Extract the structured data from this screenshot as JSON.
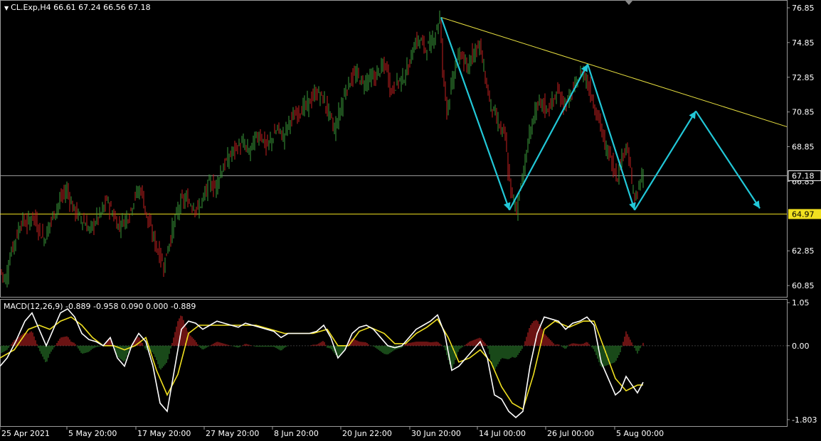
{
  "header": {
    "symbol_line": "CL.Exp,H4  66.61 67.24 66.56 67.18",
    "indicator_line": "MACD(12,26,9) -0.889 -0.958 0.090 0.000 -0.889"
  },
  "colors": {
    "background": "#000000",
    "bull": "#3a9a3a",
    "bear": "#c42020",
    "trendline": "#e8e040",
    "arrows": "#22c8d8",
    "macd_line": "#ffffff",
    "signal_line": "#f0e020",
    "hist_pos": "#b02020",
    "hist_neg": "#2a7a2a",
    "current_price_line": "#a0a0a0",
    "level_line": "#f0e020"
  },
  "chart_data": [
    {
      "type": "candlestick",
      "symbol": "CL.Exp",
      "timeframe": "H4",
      "ohlc_last": {
        "open": 66.61,
        "high": 67.24,
        "low": 66.56,
        "close": 67.18
      },
      "y_ticks": [
        "76.85",
        "74.85",
        "72.85",
        "70.85",
        "68.85",
        "66.85",
        "62.85",
        "60.85"
      ],
      "ylim": [
        60.2,
        77.3
      ],
      "x_ticks": [
        "25 Apr 2021",
        "5 May 20:00",
        "17 May 20:00",
        "27 May 20:00",
        "8 Jun 20:00",
        "20 Jun 22:00",
        "30 Jun 20:00",
        "14 Jul 00:00",
        "26 Jul 00:00",
        "5 Aug 00:00"
      ],
      "price_path": [
        [
          0,
          61.7
        ],
        [
          8,
          61.2
        ],
        [
          14,
          62.6
        ],
        [
          22,
          63.6
        ],
        [
          30,
          64.6
        ],
        [
          38,
          64.4
        ],
        [
          46,
          64.9
        ],
        [
          54,
          64.1
        ],
        [
          62,
          63.5
        ],
        [
          70,
          64.5
        ],
        [
          78,
          65.2
        ],
        [
          86,
          65.9
        ],
        [
          94,
          66.4
        ],
        [
          102,
          65.3
        ],
        [
          110,
          64.9
        ],
        [
          118,
          64.5
        ],
        [
          126,
          64.0
        ],
        [
          134,
          64.6
        ],
        [
          142,
          65.0
        ],
        [
          150,
          65.8
        ],
        [
          158,
          65.0
        ],
        [
          166,
          64.3
        ],
        [
          174,
          64.6
        ],
        [
          182,
          65.0
        ],
        [
          190,
          66.1
        ],
        [
          198,
          66.4
        ],
        [
          206,
          64.8
        ],
        [
          214,
          63.8
        ],
        [
          222,
          62.8
        ],
        [
          230,
          62.0
        ],
        [
          238,
          63.4
        ],
        [
          246,
          64.7
        ],
        [
          254,
          65.7
        ],
        [
          262,
          65.8
        ],
        [
          270,
          65.5
        ],
        [
          278,
          65.2
        ],
        [
          286,
          65.9
        ],
        [
          294,
          66.8
        ],
        [
          302,
          66.5
        ],
        [
          310,
          67.4
        ],
        [
          318,
          68.0
        ],
        [
          326,
          68.5
        ],
        [
          334,
          68.9
        ],
        [
          342,
          69.0
        ],
        [
          350,
          68.5
        ],
        [
          358,
          69.3
        ],
        [
          366,
          69.6
        ],
        [
          374,
          68.8
        ],
        [
          382,
          69.3
        ],
        [
          390,
          69.9
        ],
        [
          398,
          69.4
        ],
        [
          406,
          70.3
        ],
        [
          414,
          70.6
        ],
        [
          422,
          71.0
        ],
        [
          430,
          71.2
        ],
        [
          438,
          71.6
        ],
        [
          446,
          72.0
        ],
        [
          454,
          71.6
        ],
        [
          462,
          70.8
        ],
        [
          470,
          69.8
        ],
        [
          478,
          71.0
        ],
        [
          486,
          72.2
        ],
        [
          494,
          72.8
        ],
        [
          502,
          73.0
        ],
        [
          510,
          72.5
        ],
        [
          518,
          72.8
        ],
        [
          526,
          72.8
        ],
        [
          534,
          73.3
        ],
        [
          542,
          73.5
        ],
        [
          550,
          72.0
        ],
        [
          558,
          72.6
        ],
        [
          566,
          72.8
        ],
        [
          574,
          73.4
        ],
        [
          582,
          74.8
        ],
        [
          590,
          75.0
        ],
        [
          598,
          74.5
        ],
        [
          606,
          74.8
        ],
        [
          612,
          75.5
        ],
        [
          618,
          76.3
        ],
        [
          622,
          73.3
        ],
        [
          628,
          71.0
        ],
        [
          634,
          72.2
        ],
        [
          640,
          73.6
        ],
        [
          648,
          74.3
        ],
        [
          656,
          73.1
        ],
        [
          662,
          74.2
        ],
        [
          668,
          74.5
        ],
        [
          674,
          74.8
        ],
        [
          680,
          73.2
        ],
        [
          688,
          71.5
        ],
        [
          696,
          70.6
        ],
        [
          704,
          69.8
        ],
        [
          710,
          69.4
        ],
        [
          714,
          67.3
        ],
        [
          720,
          65.8
        ],
        [
          726,
          65.3
        ],
        [
          732,
          66.8
        ],
        [
          738,
          68.0
        ],
        [
          744,
          69.6
        ],
        [
          752,
          70.9
        ],
        [
          760,
          71.4
        ],
        [
          768,
          71.0
        ],
        [
          776,
          71.4
        ],
        [
          784,
          72.0
        ],
        [
          792,
          71.3
        ],
        [
          800,
          71.6
        ],
        [
          808,
          72.3
        ],
        [
          814,
          72.9
        ],
        [
          820,
          73.2
        ],
        [
          826,
          72.4
        ],
        [
          832,
          71.7
        ],
        [
          838,
          70.8
        ],
        [
          844,
          70.1
        ],
        [
          850,
          68.8
        ],
        [
          856,
          68.5
        ],
        [
          862,
          67.6
        ],
        [
          868,
          67.2
        ],
        [
          874,
          68.3
        ],
        [
          880,
          69.1
        ],
        [
          886,
          67.4
        ],
        [
          892,
          65.6
        ],
        [
          898,
          66.6
        ],
        [
          904,
          67.18
        ]
      ]
    },
    {
      "type": "line",
      "indicator": "MACD",
      "params": "12,26,9",
      "values": {
        "macd": -0.889,
        "signal": -0.958,
        "histogram": 0.09
      },
      "y_ticks": [
        "1.05",
        "0.00",
        "-1.803"
      ],
      "ylim": [
        -1.96,
        1.14
      ],
      "macd_path": [
        [
          0,
          -0.5
        ],
        [
          10,
          -0.3
        ],
        [
          22,
          0.1
        ],
        [
          35,
          0.6
        ],
        [
          45,
          0.8
        ],
        [
          55,
          0.4
        ],
        [
          65,
          0.0
        ],
        [
          75,
          0.4
        ],
        [
          85,
          0.8
        ],
        [
          95,
          0.9
        ],
        [
          105,
          0.7
        ],
        [
          115,
          0.3
        ],
        [
          125,
          0.15
        ],
        [
          135,
          0.1
        ],
        [
          145,
          0.0
        ],
        [
          155,
          0.2
        ],
        [
          165,
          -0.3
        ],
        [
          175,
          -0.5
        ],
        [
          185,
          0.0
        ],
        [
          195,
          0.3
        ],
        [
          205,
          0.1
        ],
        [
          215,
          -0.5
        ],
        [
          225,
          -1.4
        ],
        [
          235,
          -1.6
        ],
        [
          245,
          -0.6
        ],
        [
          255,
          0.4
        ],
        [
          265,
          0.6
        ],
        [
          275,
          0.55
        ],
        [
          285,
          0.4
        ],
        [
          295,
          0.5
        ],
        [
          305,
          0.6
        ],
        [
          315,
          0.55
        ],
        [
          325,
          0.5
        ],
        [
          335,
          0.45
        ],
        [
          345,
          0.55
        ],
        [
          355,
          0.5
        ],
        [
          365,
          0.45
        ],
        [
          375,
          0.4
        ],
        [
          385,
          0.35
        ],
        [
          395,
          0.2
        ],
        [
          405,
          0.3
        ],
        [
          415,
          0.3
        ],
        [
          425,
          0.3
        ],
        [
          435,
          0.3
        ],
        [
          445,
          0.35
        ],
        [
          455,
          0.5
        ],
        [
          465,
          0.2
        ],
        [
          475,
          -0.3
        ],
        [
          485,
          -0.1
        ],
        [
          495,
          0.3
        ],
        [
          505,
          0.45
        ],
        [
          515,
          0.5
        ],
        [
          525,
          0.4
        ],
        [
          535,
          0.2
        ],
        [
          545,
          0.0
        ],
        [
          555,
          -0.05
        ],
        [
          565,
          0.0
        ],
        [
          575,
          0.2
        ],
        [
          585,
          0.4
        ],
        [
          595,
          0.5
        ],
        [
          605,
          0.6
        ],
        [
          615,
          0.75
        ],
        [
          625,
          0.3
        ],
        [
          635,
          -0.6
        ],
        [
          645,
          -0.5
        ],
        [
          655,
          -0.3
        ],
        [
          665,
          -0.1
        ],
        [
          675,
          0.1
        ],
        [
          685,
          -0.3
        ],
        [
          695,
          -1.2
        ],
        [
          705,
          -1.3
        ],
        [
          715,
          -1.6
        ],
        [
          725,
          -1.75
        ],
        [
          735,
          -1.6
        ],
        [
          745,
          -0.5
        ],
        [
          755,
          0.3
        ],
        [
          765,
          0.7
        ],
        [
          775,
          0.65
        ],
        [
          785,
          0.6
        ],
        [
          795,
          0.4
        ],
        [
          805,
          0.55
        ],
        [
          815,
          0.6
        ],
        [
          825,
          0.7
        ],
        [
          835,
          0.5
        ],
        [
          845,
          -0.4
        ],
        [
          855,
          -0.8
        ],
        [
          865,
          -1.2
        ],
        [
          872,
          -1.1
        ],
        [
          880,
          -0.75
        ],
        [
          888,
          -0.95
        ],
        [
          896,
          -1.15
        ],
        [
          904,
          -0.889
        ]
      ],
      "signal_path": [
        [
          0,
          -0.3
        ],
        [
          20,
          -0.1
        ],
        [
          40,
          0.4
        ],
        [
          55,
          0.5
        ],
        [
          70,
          0.4
        ],
        [
          85,
          0.6
        ],
        [
          100,
          0.7
        ],
        [
          115,
          0.5
        ],
        [
          130,
          0.2
        ],
        [
          145,
          0.0
        ],
        [
          160,
          0.0
        ],
        [
          175,
          -0.1
        ],
        [
          190,
          0.0
        ],
        [
          205,
          0.2
        ],
        [
          220,
          -0.6
        ],
        [
          235,
          -1.2
        ],
        [
          250,
          -0.7
        ],
        [
          265,
          0.3
        ],
        [
          280,
          0.5
        ],
        [
          300,
          0.5
        ],
        [
          320,
          0.5
        ],
        [
          340,
          0.5
        ],
        [
          360,
          0.5
        ],
        [
          380,
          0.4
        ],
        [
          400,
          0.3
        ],
        [
          420,
          0.3
        ],
        [
          440,
          0.3
        ],
        [
          460,
          0.4
        ],
        [
          475,
          0.0
        ],
        [
          490,
          0.0
        ],
        [
          505,
          0.35
        ],
        [
          520,
          0.45
        ],
        [
          540,
          0.3
        ],
        [
          555,
          0.05
        ],
        [
          570,
          0.05
        ],
        [
          585,
          0.3
        ],
        [
          600,
          0.45
        ],
        [
          615,
          0.65
        ],
        [
          630,
          0.2
        ],
        [
          645,
          -0.4
        ],
        [
          660,
          -0.3
        ],
        [
          675,
          -0.1
        ],
        [
          690,
          -0.4
        ],
        [
          705,
          -1.0
        ],
        [
          720,
          -1.4
        ],
        [
          735,
          -1.55
        ],
        [
          750,
          -0.7
        ],
        [
          765,
          0.4
        ],
        [
          780,
          0.6
        ],
        [
          800,
          0.45
        ],
        [
          820,
          0.6
        ],
        [
          835,
          0.6
        ],
        [
          850,
          -0.1
        ],
        [
          865,
          -0.8
        ],
        [
          880,
          -1.1
        ],
        [
          896,
          -0.96
        ],
        [
          904,
          -0.958
        ]
      ]
    }
  ],
  "annotations": {
    "trendline": {
      "start": [
        620,
        76.3
      ],
      "end": [
        1106,
        70.0
      ]
    },
    "arrow_path": [
      [
        620,
        76.3
      ],
      [
        716,
        65.2
      ],
      [
        826,
        73.6
      ],
      [
        892,
        65.2
      ],
      [
        978,
        70.9
      ],
      [
        1068,
        65.3
      ]
    ],
    "current_price_label": "67.18",
    "current_price": 67.18,
    "level_label": "64.97",
    "level": 64.97
  }
}
